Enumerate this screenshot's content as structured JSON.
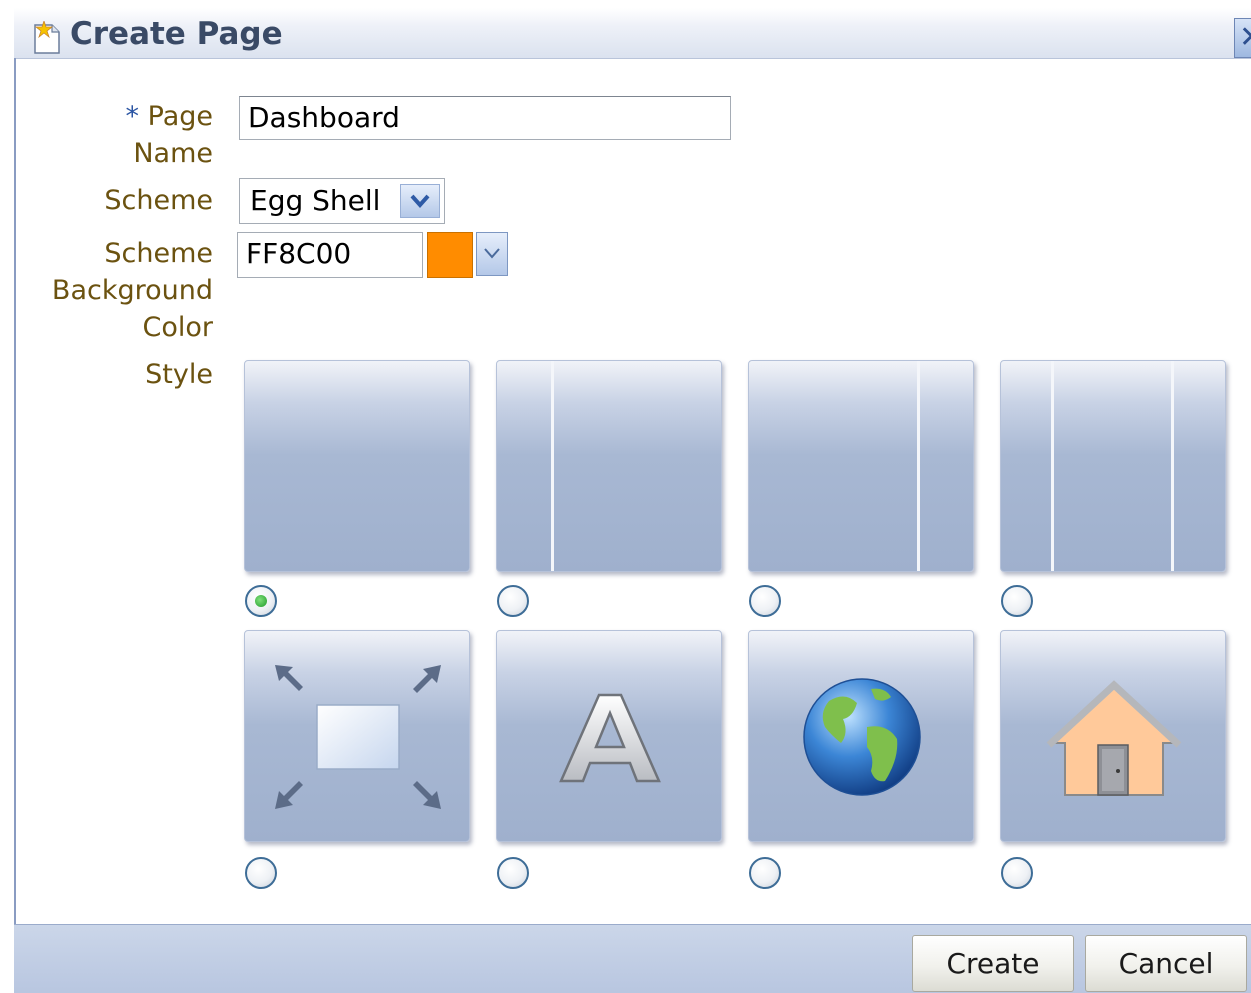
{
  "dialog": {
    "title": "Create Page",
    "close_label": "✕"
  },
  "form": {
    "page_name": {
      "required_marker": "*",
      "label_line1": "Page",
      "label_line2": "Name",
      "value": "Dashboard"
    },
    "scheme": {
      "label": "Scheme",
      "value": "Egg Shell"
    },
    "scheme_background_color": {
      "label_line1": "Scheme",
      "label_line2": "Background",
      "label_line3": "Color",
      "value": "FF8C00",
      "swatch_color": "#FF8C00"
    },
    "style": {
      "label": "Style",
      "options": [
        {
          "name": "one-column",
          "selected": true
        },
        {
          "name": "narrow-left-column",
          "selected": false
        },
        {
          "name": "narrow-right-column",
          "selected": false
        },
        {
          "name": "three-column",
          "selected": false
        },
        {
          "name": "stretch",
          "icon": "resize-arrows-icon",
          "selected": false
        },
        {
          "name": "text",
          "icon": "letter-a-icon",
          "selected": false
        },
        {
          "name": "web",
          "icon": "globe-icon",
          "selected": false
        },
        {
          "name": "home",
          "icon": "house-icon",
          "selected": false
        }
      ]
    }
  },
  "footer": {
    "create_label": "Create",
    "cancel_label": "Cancel"
  }
}
